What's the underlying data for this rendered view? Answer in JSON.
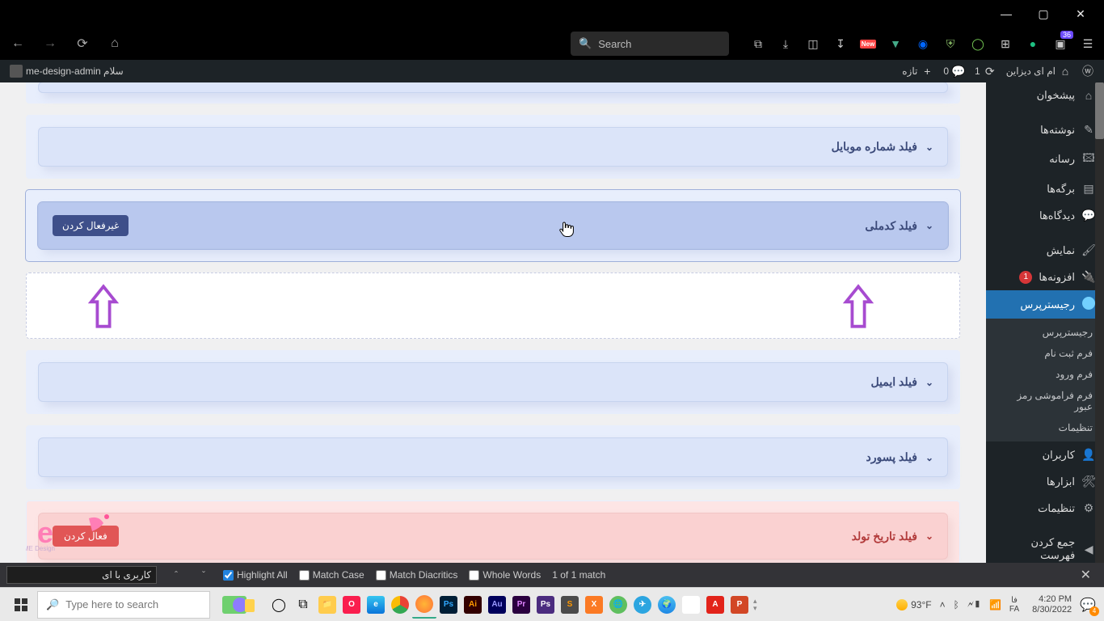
{
  "window": {
    "min": "—",
    "max": "▢",
    "close": "✕"
  },
  "browser": {
    "search_placeholder": "Search",
    "badge_count": "36",
    "new_badge": "New"
  },
  "wpbar": {
    "site_name": "ام ای دیزاین",
    "updates": "1",
    "comments": "0",
    "new": "تازه",
    "greeting": "سلام me-design-admin"
  },
  "sidebar": {
    "items": [
      {
        "icon": "⌂",
        "label": "پیشخوان"
      },
      {
        "icon": "✎",
        "label": "نوشته‌ها"
      },
      {
        "icon": "🖾",
        "label": "رسانه"
      },
      {
        "icon": "▤",
        "label": "برگه‌ها"
      },
      {
        "icon": "💬",
        "label": "دیدگاه‌ها"
      },
      {
        "icon": "🖌",
        "label": "نمایش"
      },
      {
        "icon": "🔌",
        "label": "افزونه‌ها",
        "badge": "1"
      },
      {
        "icon": "●",
        "label": "رجیسترپرس",
        "active": true
      },
      {
        "icon": "👤",
        "label": "کاربران"
      },
      {
        "icon": "🛠",
        "label": "ابزارها"
      },
      {
        "icon": "⚙",
        "label": "تنظیمات"
      },
      {
        "icon": "◀",
        "label": "جمع کردن فهرست"
      }
    ],
    "sub": [
      "رجیسترپرس",
      "فرم ثبت نام",
      "فرم ورود",
      "فرم فراموشی رمز عبور",
      "تنظیمات"
    ]
  },
  "fields": {
    "partial_top": "",
    "mobile": "فیلد شماره موبایل",
    "national": "فیلد کدملی",
    "deactivate": "غیرفعال کردن",
    "email": "فیلد ایمیل",
    "password": "فیلد پسورد",
    "birthdate": "فیلد تاریخ تولد",
    "activate": "فعال کردن"
  },
  "findbar": {
    "query": "کاربری با ای",
    "highlight": "Highlight All",
    "matchcase": "Match Case",
    "diacritics": "Match Diacritics",
    "whole": "Whole Words",
    "matches": "1 of 1 match"
  },
  "taskbar": {
    "search_placeholder": "Type here to search",
    "weather": "93°F",
    "lang1": "فا",
    "lang2": "FA",
    "time": "4:20 PM",
    "date": "8/30/2022",
    "notif": "4"
  }
}
